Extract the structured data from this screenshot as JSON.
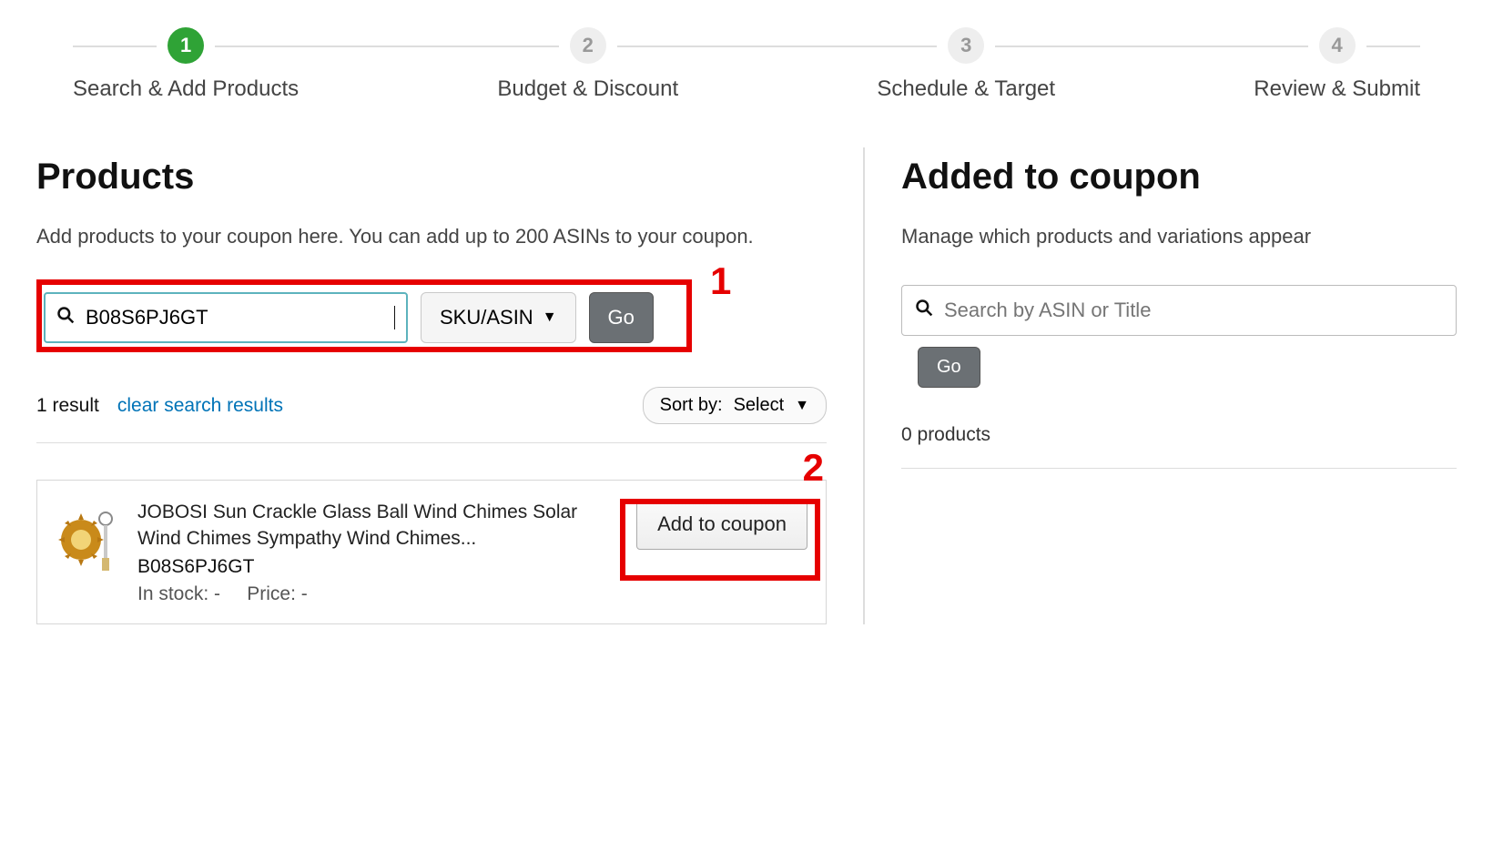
{
  "stepper": {
    "steps": [
      {
        "num": "1",
        "label": "Search & Add Products",
        "active": true
      },
      {
        "num": "2",
        "label": "Budget & Discount",
        "active": false
      },
      {
        "num": "3",
        "label": "Schedule & Target",
        "active": false
      },
      {
        "num": "4",
        "label": "Review & Submit",
        "active": false
      }
    ]
  },
  "left": {
    "title": "Products",
    "subtitle": "Add products to your coupon here. You can add up to 200 ASINs to your coupon.",
    "search_value": "B08S6PJ6GT",
    "search_type_label": "SKU/ASIN",
    "go_label": "Go",
    "result_count": "1 result",
    "clear_label": "clear search results",
    "sort_label": "Sort by:",
    "sort_value": "Select",
    "product": {
      "title": "JOBOSI Sun Crackle Glass Ball Wind Chimes Solar Wind Chimes Sympathy Wind Chimes...",
      "asin": "B08S6PJ6GT",
      "stock_label": "In stock:",
      "stock_value": "-",
      "price_label": "Price:",
      "price_value": "-",
      "add_button": "Add to coupon"
    }
  },
  "right": {
    "title": "Added to coupon",
    "subtitle": "Manage which products and variations appear",
    "search_placeholder": "Search by ASIN or Title",
    "go_label": "Go",
    "products_count": "0 products"
  },
  "annotations": {
    "label1": "1",
    "label2": "2"
  }
}
